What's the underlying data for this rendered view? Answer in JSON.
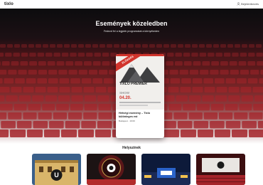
{
  "topbar": {
    "logo": "tixlo",
    "login_label": "Bejelentkezés",
    "user_icon": "user-icon"
  },
  "hero": {
    "title": "Események közeledben",
    "subtitle": "Fedezd fel a legjobb programokat a környékeden"
  },
  "featured_event": {
    "ribbon": "ELŐADÁS",
    "poster_title": "TIXLO PREMIER",
    "poster_subtitle": "SHOW",
    "poster_date": "04.20.",
    "title": "Hétvégi esemény – Tixlo különleges est",
    "meta": "Budapest · 19:00"
  },
  "venues": {
    "title": "Helyszínek",
    "items": [
      {
        "name": "venue-1",
        "accent": "#c9a24a"
      },
      {
        "name": "venue-2",
        "accent": "#b22b2b"
      },
      {
        "name": "venue-3",
        "accent": "#2b63c9"
      },
      {
        "name": "venue-4",
        "accent": "#c92b2b"
      }
    ]
  },
  "colors": {
    "brand_red": "#d1342c",
    "hero_dark": "#0c0c0e",
    "seat_red": "#a5242a"
  }
}
